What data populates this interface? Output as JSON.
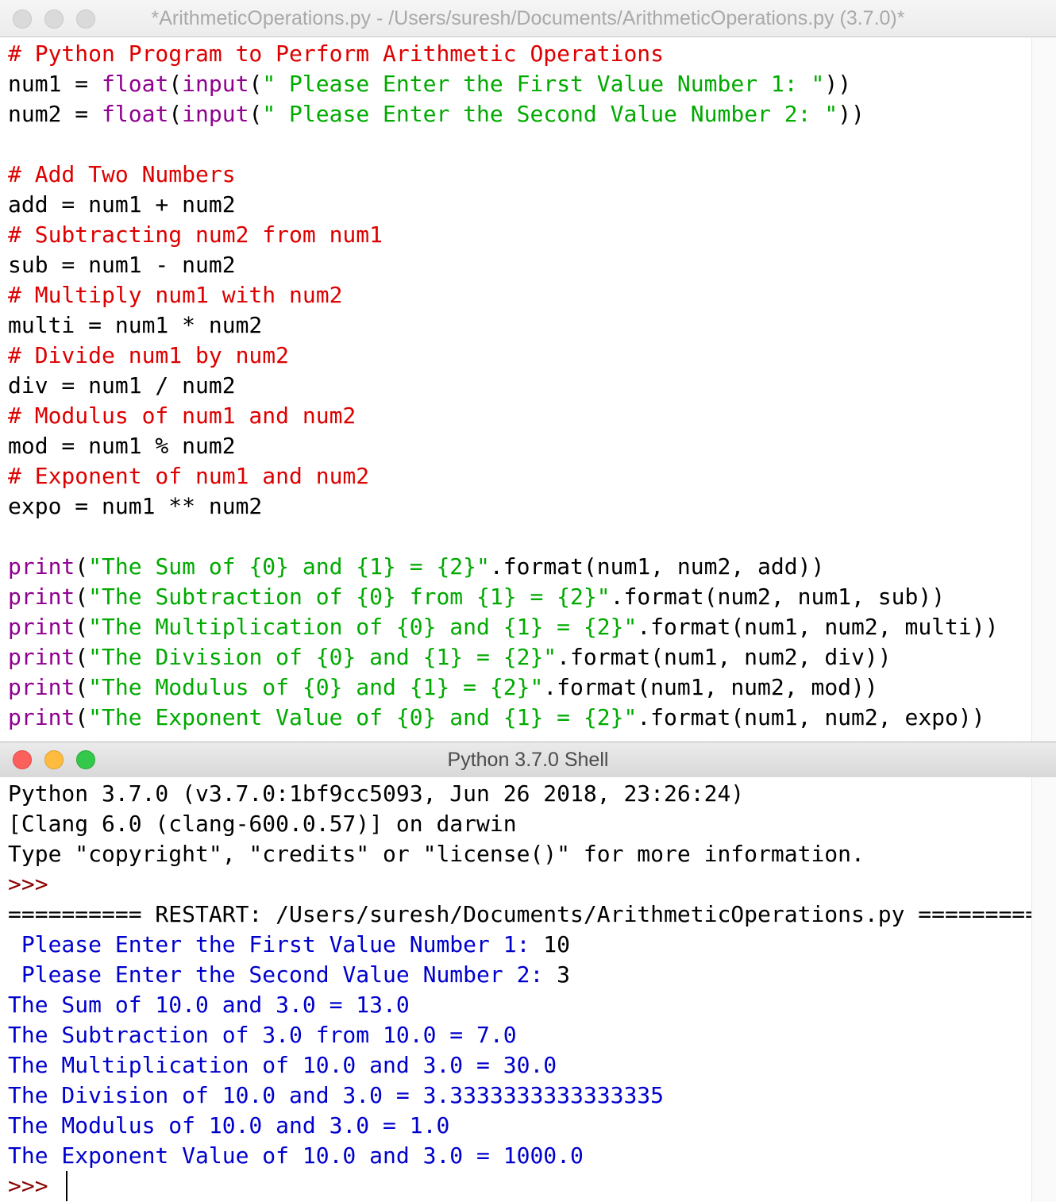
{
  "editor": {
    "title": "*ArithmeticOperations.py - /Users/suresh/Documents/ArithmeticOperations.py (3.7.0)*",
    "lines": [
      {
        "comment": "# Python Program to Perform Arithmetic Operations"
      },
      {
        "pre": "num1 = ",
        "kw1": "float",
        "mid": "(",
        "kw2": "input",
        "open": "(",
        "str": "\" Please Enter the First Value Number 1: \"",
        "post": "))"
      },
      {
        "pre": "num2 = ",
        "kw1": "float",
        "mid": "(",
        "kw2": "input",
        "open": "(",
        "str": "\" Please Enter the Second Value Number 2: \"",
        "post": "))"
      },
      {},
      {
        "comment": "# Add Two Numbers"
      },
      {
        "pre": "add = num1 + num2"
      },
      {
        "comment": "# Subtracting num2 from num1"
      },
      {
        "pre": "sub = num1 - num2"
      },
      {
        "comment": "# Multiply num1 with num2"
      },
      {
        "pre": "multi = num1 * num2"
      },
      {
        "comment": "# Divide num1 by num2"
      },
      {
        "pre": "div = num1 / num2"
      },
      {
        "comment": "# Modulus of num1 and num2"
      },
      {
        "pre": "mod = num1 % num2"
      },
      {
        "comment": "# Exponent of num1 and num2"
      },
      {
        "pre": "expo = num1 ** num2"
      },
      {},
      {
        "kw1": "print",
        "open": "(",
        "str": "\"The Sum of {0} and {1} = {2}\"",
        "post": ".format(num1, num2, add))"
      },
      {
        "kw1": "print",
        "open": "(",
        "str": "\"The Subtraction of {0} from {1} = {2}\"",
        "post": ".format(num2, num1, sub))"
      },
      {
        "kw1": "print",
        "open": "(",
        "str": "\"The Multiplication of {0} and {1} = {2}\"",
        "post": ".format(num1, num2, multi))"
      },
      {
        "kw1": "print",
        "open": "(",
        "str": "\"The Division of {0} and {1} = {2}\"",
        "post": ".format(num1, num2, div))"
      },
      {
        "kw1": "print",
        "open": "(",
        "str": "\"The Modulus of {0} and {1} = {2}\"",
        "post": ".format(num1, num2, mod))"
      },
      {
        "kw1": "print",
        "open": "(",
        "str": "\"The Exponent Value of {0} and {1} = {2}\"",
        "post": ".format(num1, num2, expo))"
      }
    ]
  },
  "shell": {
    "title": "Python 3.7.0 Shell",
    "lines": [
      {
        "text": "Python 3.7.0 (v3.7.0:1bf9cc5093, Jun 26 2018, 23:26:24)"
      },
      {
        "text": "[Clang 6.0 (clang-600.0.57)] on darwin"
      },
      {
        "text": "Type \"copyright\", \"credits\" or \"license()\" for more information."
      },
      {
        "prompt": ">>> "
      },
      {
        "text": "========== RESTART: /Users/suresh/Documents/ArithmeticOperations.py =========="
      },
      {
        "out": " Please Enter the First Value Number 1: ",
        "input": "10"
      },
      {
        "out": " Please Enter the Second Value Number 2: ",
        "input": "3"
      },
      {
        "out": "The Sum of 10.0 and 3.0 = 13.0"
      },
      {
        "out": "The Subtraction of 3.0 from 10.0 = 7.0"
      },
      {
        "out": "The Multiplication of 10.0 and 3.0 = 30.0"
      },
      {
        "out": "The Division of 10.0 and 3.0 = 3.3333333333333335"
      },
      {
        "out": "The Modulus of 10.0 and 3.0 = 1.0"
      },
      {
        "out": "The Exponent Value of 10.0 and 3.0 = 1000.0"
      }
    ],
    "final_prompt": ">>> "
  },
  "colors": {
    "comment": "#dd0000",
    "keyword": "#900090",
    "string": "#00aa00",
    "output": "#0000cc",
    "prompt": "#8b0000"
  }
}
